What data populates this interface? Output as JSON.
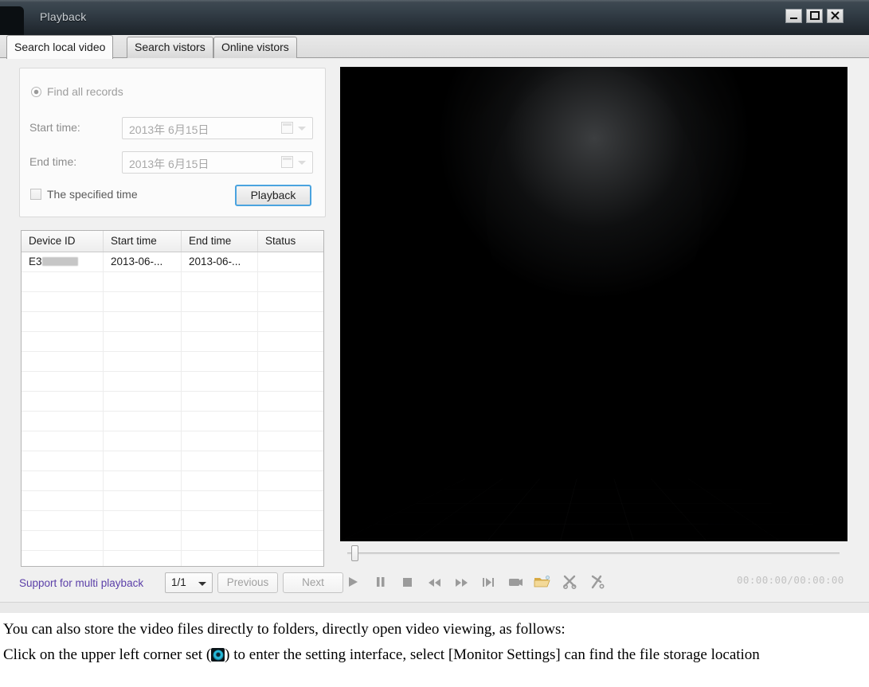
{
  "window": {
    "title": "Playback",
    "controls": {
      "minimize": "minimize",
      "maximize": "maximize",
      "close": "close"
    }
  },
  "tabs": [
    {
      "label": "Search local video",
      "active": true
    },
    {
      "label": "Search vistors",
      "active": false
    },
    {
      "label": "Online vistors",
      "active": false
    }
  ],
  "search_panel": {
    "find_all_records_label": "Find all records",
    "find_all_records_checked": true,
    "start_time_label": "Start time:",
    "start_time_value": "2013年 6月15日",
    "end_time_label": "End time:",
    "end_time_value": "2013年 6月15日",
    "specified_time_label": "The specified time",
    "specified_time_checked": false,
    "playback_button_label": "Playback"
  },
  "table": {
    "columns": [
      "Device ID",
      "Start time",
      "End time",
      "Status"
    ],
    "rows": [
      {
        "device_id": "E3",
        "device_id_redacted": true,
        "start_time": "2013-06-...",
        "end_time": "2013-06-...",
        "status": ""
      }
    ],
    "empty_row_count": 15
  },
  "pager": {
    "multi_playback_label": "Support for multi playback",
    "page_value": "1/1",
    "previous_label": "Previous",
    "next_label": "Next"
  },
  "player": {
    "timecode": "00:00:00/00:00:00",
    "seek_position_percent": 0,
    "controls": [
      {
        "name": "play-icon",
        "label": "Play"
      },
      {
        "name": "pause-icon",
        "label": "Pause"
      },
      {
        "name": "stop-icon",
        "label": "Stop"
      },
      {
        "name": "rewind-icon",
        "label": "Rewind"
      },
      {
        "name": "fast-forward-icon",
        "label": "Fast forward"
      },
      {
        "name": "step-frame-icon",
        "label": "Step frame"
      },
      {
        "name": "snapshot-icon",
        "label": "Snapshot"
      },
      {
        "name": "open-folder-icon",
        "label": "Open folder"
      },
      {
        "name": "clip-start-icon",
        "label": "Clip start"
      },
      {
        "name": "clip-end-icon",
        "label": "Clip end"
      }
    ]
  },
  "caption": {
    "line1": "You can also store the video files directly to folders, directly open video viewing, as follows:",
    "line2_before": "Click on the upper left corner set (",
    "line2_after": ") to enter the setting interface, select [Monitor Settings] can find the file storage location"
  },
  "colors": {
    "title_bar": "#2a333b",
    "accent_focus": "#4aa3df",
    "link": "#5b3fa8",
    "gear_teal": "#29c6e6",
    "folder_yellow": "#e8c46a"
  }
}
